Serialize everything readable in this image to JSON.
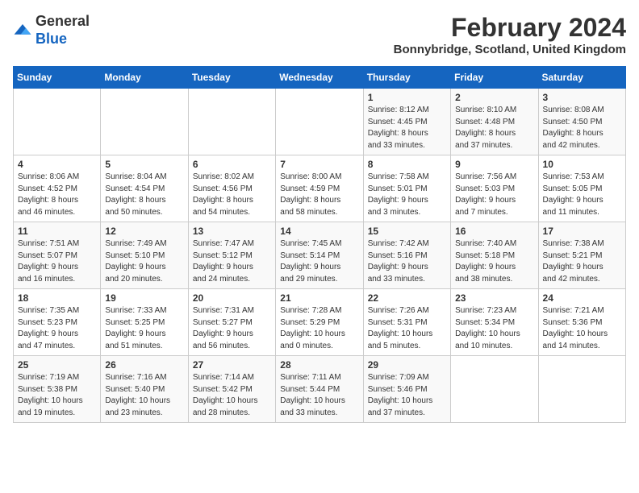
{
  "logo": {
    "general": "General",
    "blue": "Blue"
  },
  "title": "February 2024",
  "location": "Bonnybridge, Scotland, United Kingdom",
  "days_of_week": [
    "Sunday",
    "Monday",
    "Tuesday",
    "Wednesday",
    "Thursday",
    "Friday",
    "Saturday"
  ],
  "weeks": [
    [
      {
        "day": "",
        "info": ""
      },
      {
        "day": "",
        "info": ""
      },
      {
        "day": "",
        "info": ""
      },
      {
        "day": "",
        "info": ""
      },
      {
        "day": "1",
        "info": "Sunrise: 8:12 AM\nSunset: 4:45 PM\nDaylight: 8 hours\nand 33 minutes."
      },
      {
        "day": "2",
        "info": "Sunrise: 8:10 AM\nSunset: 4:48 PM\nDaylight: 8 hours\nand 37 minutes."
      },
      {
        "day": "3",
        "info": "Sunrise: 8:08 AM\nSunset: 4:50 PM\nDaylight: 8 hours\nand 42 minutes."
      }
    ],
    [
      {
        "day": "4",
        "info": "Sunrise: 8:06 AM\nSunset: 4:52 PM\nDaylight: 8 hours\nand 46 minutes."
      },
      {
        "day": "5",
        "info": "Sunrise: 8:04 AM\nSunset: 4:54 PM\nDaylight: 8 hours\nand 50 minutes."
      },
      {
        "day": "6",
        "info": "Sunrise: 8:02 AM\nSunset: 4:56 PM\nDaylight: 8 hours\nand 54 minutes."
      },
      {
        "day": "7",
        "info": "Sunrise: 8:00 AM\nSunset: 4:59 PM\nDaylight: 8 hours\nand 58 minutes."
      },
      {
        "day": "8",
        "info": "Sunrise: 7:58 AM\nSunset: 5:01 PM\nDaylight: 9 hours\nand 3 minutes."
      },
      {
        "day": "9",
        "info": "Sunrise: 7:56 AM\nSunset: 5:03 PM\nDaylight: 9 hours\nand 7 minutes."
      },
      {
        "day": "10",
        "info": "Sunrise: 7:53 AM\nSunset: 5:05 PM\nDaylight: 9 hours\nand 11 minutes."
      }
    ],
    [
      {
        "day": "11",
        "info": "Sunrise: 7:51 AM\nSunset: 5:07 PM\nDaylight: 9 hours\nand 16 minutes."
      },
      {
        "day": "12",
        "info": "Sunrise: 7:49 AM\nSunset: 5:10 PM\nDaylight: 9 hours\nand 20 minutes."
      },
      {
        "day": "13",
        "info": "Sunrise: 7:47 AM\nSunset: 5:12 PM\nDaylight: 9 hours\nand 24 minutes."
      },
      {
        "day": "14",
        "info": "Sunrise: 7:45 AM\nSunset: 5:14 PM\nDaylight: 9 hours\nand 29 minutes."
      },
      {
        "day": "15",
        "info": "Sunrise: 7:42 AM\nSunset: 5:16 PM\nDaylight: 9 hours\nand 33 minutes."
      },
      {
        "day": "16",
        "info": "Sunrise: 7:40 AM\nSunset: 5:18 PM\nDaylight: 9 hours\nand 38 minutes."
      },
      {
        "day": "17",
        "info": "Sunrise: 7:38 AM\nSunset: 5:21 PM\nDaylight: 9 hours\nand 42 minutes."
      }
    ],
    [
      {
        "day": "18",
        "info": "Sunrise: 7:35 AM\nSunset: 5:23 PM\nDaylight: 9 hours\nand 47 minutes."
      },
      {
        "day": "19",
        "info": "Sunrise: 7:33 AM\nSunset: 5:25 PM\nDaylight: 9 hours\nand 51 minutes."
      },
      {
        "day": "20",
        "info": "Sunrise: 7:31 AM\nSunset: 5:27 PM\nDaylight: 9 hours\nand 56 minutes."
      },
      {
        "day": "21",
        "info": "Sunrise: 7:28 AM\nSunset: 5:29 PM\nDaylight: 10 hours\nand 0 minutes."
      },
      {
        "day": "22",
        "info": "Sunrise: 7:26 AM\nSunset: 5:31 PM\nDaylight: 10 hours\nand 5 minutes."
      },
      {
        "day": "23",
        "info": "Sunrise: 7:23 AM\nSunset: 5:34 PM\nDaylight: 10 hours\nand 10 minutes."
      },
      {
        "day": "24",
        "info": "Sunrise: 7:21 AM\nSunset: 5:36 PM\nDaylight: 10 hours\nand 14 minutes."
      }
    ],
    [
      {
        "day": "25",
        "info": "Sunrise: 7:19 AM\nSunset: 5:38 PM\nDaylight: 10 hours\nand 19 minutes."
      },
      {
        "day": "26",
        "info": "Sunrise: 7:16 AM\nSunset: 5:40 PM\nDaylight: 10 hours\nand 23 minutes."
      },
      {
        "day": "27",
        "info": "Sunrise: 7:14 AM\nSunset: 5:42 PM\nDaylight: 10 hours\nand 28 minutes."
      },
      {
        "day": "28",
        "info": "Sunrise: 7:11 AM\nSunset: 5:44 PM\nDaylight: 10 hours\nand 33 minutes."
      },
      {
        "day": "29",
        "info": "Sunrise: 7:09 AM\nSunset: 5:46 PM\nDaylight: 10 hours\nand 37 minutes."
      },
      {
        "day": "",
        "info": ""
      },
      {
        "day": "",
        "info": ""
      }
    ]
  ]
}
